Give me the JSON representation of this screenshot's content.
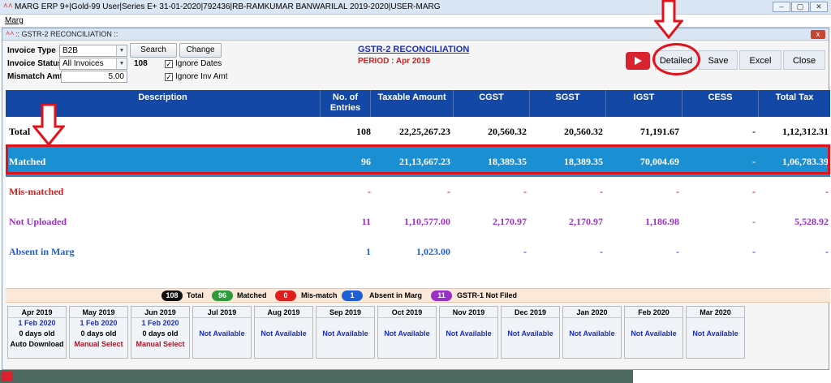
{
  "app": {
    "title": "MARG ERP 9+|Gold-99 User|Series E+ 31-01-2020|792436|RB-RAMKUMAR BANWARILAL 2019-2020|USER-MARG",
    "logo": "^^",
    "menu": "Marg"
  },
  "window": {
    "title": ":: GSTR-2 RECONCILIATION ::",
    "close": "x"
  },
  "filters": {
    "invoice_type_label": "Invoice Type",
    "invoice_type_value": "B2B",
    "invoice_status_label": "Invoice Status",
    "invoice_status_value": "All Invoices",
    "invoice_count": "108",
    "mismatch_label": "Mismatch Amt",
    "mismatch_value": "5.00",
    "search_label": "Search",
    "change_label": "Change",
    "ignore_dates": "Ignore Dates",
    "ignore_inv_amt": "Ignore Inv Amt"
  },
  "header": {
    "title": "GSTR-2 RECONCILIATION",
    "period": "PERIOD : Apr 2019"
  },
  "toolbar": {
    "detailed": "Detailed",
    "save": "Save",
    "excel": "Excel",
    "close": "Close"
  },
  "table": {
    "columns": [
      "Description",
      "No. of Entries",
      "Taxable Amount",
      "CGST",
      "SGST",
      "IGST",
      "CESS",
      "Total Tax"
    ],
    "rows": [
      {
        "description": "Total",
        "entries": "108",
        "taxable": "22,25,267.23",
        "cgst": "20,560.32",
        "sgst": "20,560.32",
        "igst": "71,191.67",
        "cess": "-",
        "total_tax": "1,12,312.31"
      },
      {
        "description": "Matched",
        "entries": "96",
        "taxable": "21,13,667.23",
        "cgst": "18,389.35",
        "sgst": "18,389.35",
        "igst": "70,004.69",
        "cess": "-",
        "total_tax": "1,06,783.39"
      },
      {
        "description": "Mis-matched",
        "entries": "-",
        "taxable": "-",
        "cgst": "-",
        "sgst": "-",
        "igst": "-",
        "cess": "-",
        "total_tax": "-"
      },
      {
        "description": "Not Uploaded",
        "entries": "11",
        "taxable": "1,10,577.00",
        "cgst": "2,170.97",
        "sgst": "2,170.97",
        "igst": "1,186.98",
        "cess": "-",
        "total_tax": "5,528.92"
      },
      {
        "description": "Absent in Marg",
        "entries": "1",
        "taxable": "1,023.00",
        "cgst": "-",
        "sgst": "-",
        "igst": "-",
        "cess": "-",
        "total_tax": "-"
      }
    ]
  },
  "legend": [
    {
      "count": "108",
      "label": "Total",
      "color": "#111111"
    },
    {
      "count": "96",
      "label": "Matched",
      "color": "#2e9a3e"
    },
    {
      "count": "0",
      "label": "Mis-match",
      "color": "#e21d1d"
    },
    {
      "count": "1",
      "label": "Absent in Marg",
      "color": "#1f5fd6"
    },
    {
      "count": "11",
      "label": "GSTR-1 Not Filed",
      "color": "#9b30c8"
    }
  ],
  "months": [
    {
      "name": "Apr 2019",
      "date": "1 Feb 2020",
      "age": "0 days old",
      "mode": "Auto Download"
    },
    {
      "name": "May 2019",
      "date": "1 Feb 2020",
      "age": "0 days old",
      "mode": "Manual Select"
    },
    {
      "name": "Jun 2019",
      "date": "1 Feb 2020",
      "age": "0 days old",
      "mode": "Manual Select"
    },
    {
      "name": "Jul 2019",
      "status": "Not Available"
    },
    {
      "name": "Aug 2019",
      "status": "Not Available"
    },
    {
      "name": "Sep 2019",
      "status": "Not Available"
    },
    {
      "name": "Oct 2019",
      "status": "Not Available"
    },
    {
      "name": "Nov 2019",
      "status": "Not Available"
    },
    {
      "name": "Dec 2019",
      "status": "Not Available"
    },
    {
      "name": "Jan 2020",
      "status": "Not Available"
    },
    {
      "name": "Feb 2020",
      "status": "Not Available"
    },
    {
      "name": "Mar 2020",
      "status": "Not Available"
    }
  ],
  "colors": {
    "header_blue": "#1448a7",
    "matched_row": "#1a8fd1",
    "red": "#d21e1e",
    "purple": "#9b30c8",
    "blue_text": "#1f5fd6"
  }
}
